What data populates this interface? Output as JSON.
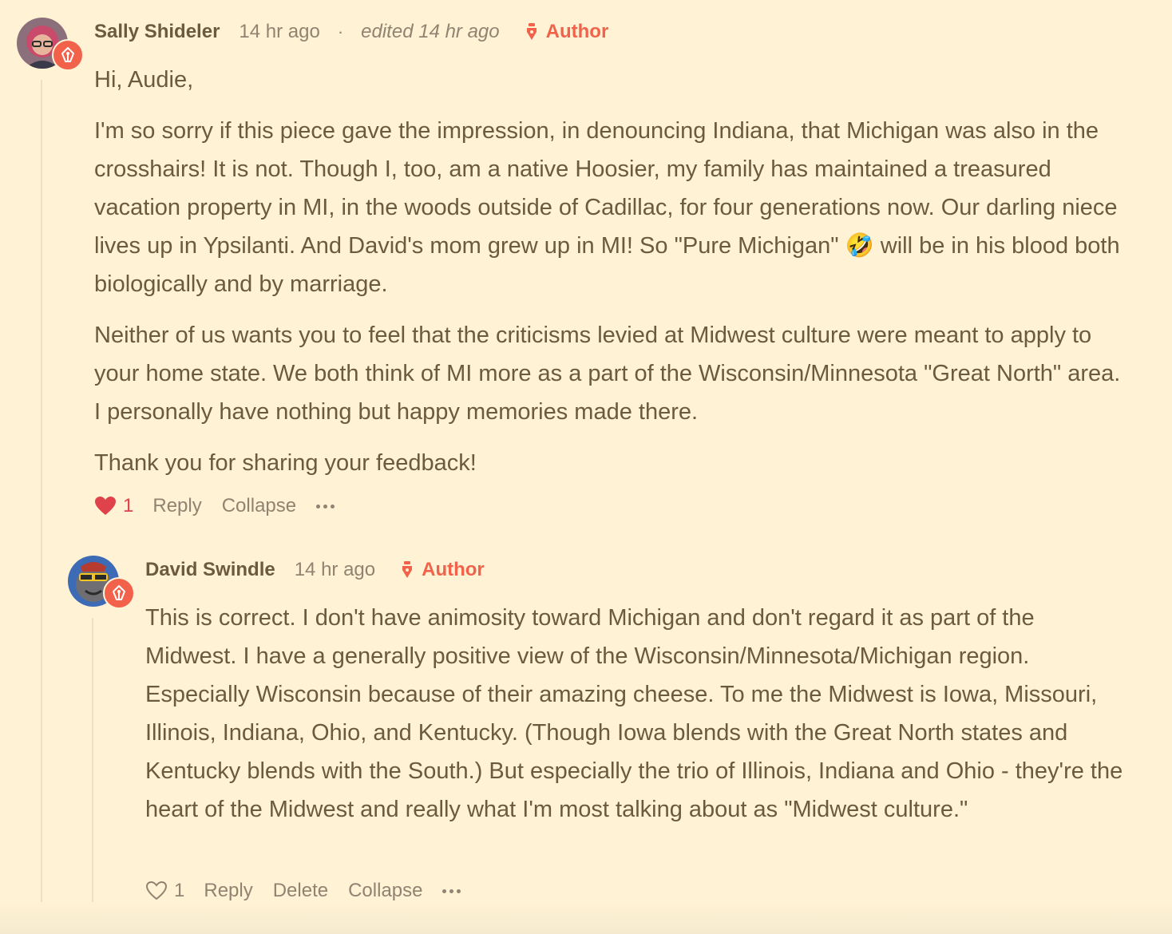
{
  "comments": [
    {
      "author": "Sally Shideler",
      "time": "14 hr ago",
      "separator": "·",
      "edited": "edited 14 hr ago",
      "author_badge_label": "Author",
      "paragraphs": [
        "Hi, Audie,",
        "I'm so sorry if this piece gave the impression, in denouncing Indiana, that Michigan was also in the crosshairs! It is not. Though I, too, am a native Hoosier, my family has maintained a treasured vacation property in MI, in the woods outside of Cadillac, for four generations now. Our darling niece lives up in Ypsilanti. And David's mom grew up in MI! So \"Pure Michigan\" 🤣 will be in his blood both biologically and by marriage.",
        "Neither of us wants you to feel that the criticisms levied at Midwest culture were meant to apply to your home state. We both think of MI more as a part of the Wisconsin/Minnesota \"Great North\" area. I personally have nothing but happy memories made there.",
        "Thank you for sharing your feedback!"
      ],
      "like_count": "1",
      "liked": true,
      "actions": [
        "Reply",
        "Collapse"
      ],
      "colors": {
        "heart": "#e0424b"
      }
    },
    {
      "author": "David Swindle",
      "time": "14 hr ago",
      "author_badge_label": "Author",
      "paragraphs": [
        "This is correct. I don't have animosity toward Michigan and don't regard it as part of the Midwest. I have a generally positive view of the Wisconsin/Minnesota/Michigan region. Especially Wisconsin because of their amazing cheese. To me the Midwest is Iowa, Missouri, Illinois, Indiana, Ohio, and Kentucky. (Though Iowa blends with the Great North states and Kentucky blends with the South.) But especially the trio of Illinois, Indiana and Ohio - they're the heart of the Midwest and really what I'm most talking about as \"Midwest culture.\""
      ],
      "like_count": "1",
      "liked": false,
      "actions": [
        "Reply",
        "Delete",
        "Collapse"
      ]
    }
  ],
  "colors": {
    "background": "#fff2d5",
    "accent": "#f2624b",
    "text": "#6b5a3f",
    "muted": "#8f8471"
  }
}
